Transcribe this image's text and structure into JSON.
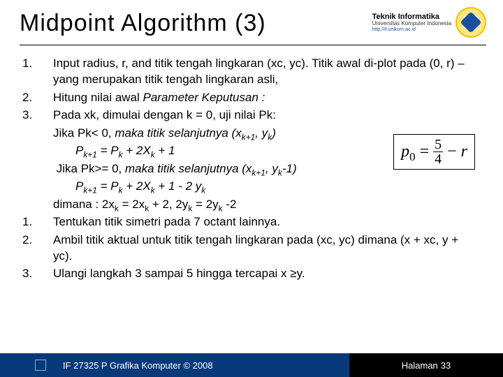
{
  "title": "Midpoint Algorithm (3)",
  "brand": {
    "line1": "Teknik Informatika",
    "line2": "Universitas Komputer Indonesia",
    "line3": "http://if.unikom.ac.id"
  },
  "steps": {
    "n1": "1.",
    "t1": "Input radius, r, and titik tengah lingkaran (xc, yc). Titik awal di-plot pada (0, r) –yang merupakan titik tengah lingkaran asli,",
    "n2": "2.",
    "t2a": "Hitung nilai awal ",
    "t2b": "Parameter Keputusan :",
    "n3": "3.",
    "t3": "Pada xk, dimulai dengan k = 0, uji nilai Pk:",
    "t3a_pre": "Jika Pk< 0, ",
    "t3a_it": "maka titik selanjutnya (x",
    "t3a_sub1": "k+1",
    "t3a_mid": ", y",
    "t3a_sub2": "k",
    "t3a_end": ")",
    "t3b_pre": "P",
    "t3b_sub1": "k+1",
    "t3b_mid": " = P",
    "t3b_sub2": "k",
    "t3b_mid2": " + 2X",
    "t3b_sub3": "k",
    "t3b_end": " + 1",
    "t3c_pre": "Jika Pk>= 0, ",
    "t3c_it": "maka titik selanjutnya (x",
    "t3c_sub1": "k+1",
    "t3c_mid": ", y",
    "t3c_sub2": "k",
    "t3c_end": "-1)",
    "t3d_pre": "P",
    "t3d_sub1": "k+1",
    "t3d_mid": " = P",
    "t3d_sub2": "k",
    "t3d_mid2": " + 2X",
    "t3d_sub3": "k",
    "t3d_mid3": " + 1 - 2 y",
    "t3d_sub4": "k",
    "t3e_pre": "dimana : 2x",
    "t3e_s1": "k",
    "t3e_m1": " = 2x",
    "t3e_s2": "k",
    "t3e_m2": " + 2, 2y",
    "t3e_s3": "k",
    "t3e_m3": " = 2y",
    "t3e_s4": "k",
    "t3e_end": " -2",
    "n4": "1.",
    "t4": "Tentukan titik simetri pada 7 octant lainnya.",
    "n5": "2.",
    "t5": "Ambil titik aktual untuk titik tengah lingkaran pada (xc, yc) dimana (x + xc, y + yc).",
    "n6": "3.",
    "t6": "Ulangi langkah 3 sampai 5 hingga tercapai x ≥y."
  },
  "formula": {
    "p": "p",
    "zero": "0",
    "eq": "=",
    "num": "5",
    "den": "4",
    "minus": "−",
    "r": "r"
  },
  "footer": {
    "left": "IF 27325 P Grafika Komputer © 2008",
    "right_label": "Halaman",
    "right_num": "33"
  }
}
